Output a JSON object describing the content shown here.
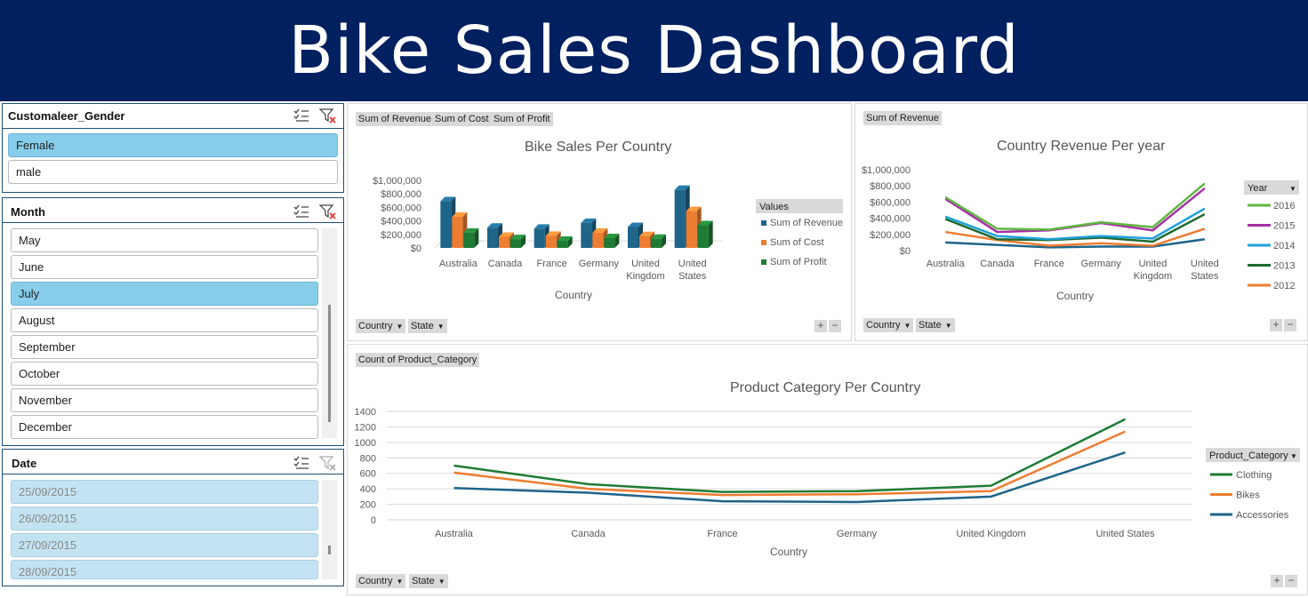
{
  "title": "Bike Sales Dashboard",
  "slicers": {
    "gender": {
      "title": "Customaleer_Gender",
      "items": [
        {
          "label": "Female",
          "state": "selected"
        },
        {
          "label": "male",
          "state": "normal"
        }
      ]
    },
    "month": {
      "title": "Month",
      "items": [
        {
          "label": "May",
          "state": "normal"
        },
        {
          "label": "June",
          "state": "normal"
        },
        {
          "label": "July",
          "state": "selected"
        },
        {
          "label": "August",
          "state": "normal"
        },
        {
          "label": "September",
          "state": "normal"
        },
        {
          "label": "October",
          "state": "normal"
        },
        {
          "label": "November",
          "state": "normal"
        },
        {
          "label": "December",
          "state": "normal"
        }
      ]
    },
    "date": {
      "title": "Date",
      "items": [
        {
          "label": "25/09/2015",
          "state": "dim"
        },
        {
          "label": "26/09/2015",
          "state": "dim"
        },
        {
          "label": "27/09/2015",
          "state": "dim"
        },
        {
          "label": "28/09/2015",
          "state": "dim"
        }
      ]
    }
  },
  "field_buttons": {
    "country": "Country",
    "state": "State"
  },
  "colors": {
    "header": "#002060",
    "revenue": "#1f6489",
    "cost": "#ed7d31",
    "profit": "#1e7b34",
    "y2016": "#5fb843",
    "y2015": "#a531a4",
    "y2014": "#1fa0d8",
    "y2013": "#1e6b32",
    "y2012": "#ed7d31",
    "clothing": "#1e7b34",
    "bikes": "#ed7d31",
    "accessories": "#1f6489"
  },
  "chart_data": [
    {
      "type": "bar",
      "title": "Bike Sales Per Country",
      "value_pills": [
        "Sum of Revenue",
        "Sum of Cost",
        "Sum of Profit"
      ],
      "legend_title": "Values",
      "xlabel": "Country",
      "categories": [
        "Australia",
        "Canada",
        "France",
        "Germany",
        "United Kingdom",
        "United States"
      ],
      "series": [
        {
          "name": "Sum of Revenue",
          "values": [
            690000,
            300000,
            285000,
            370000,
            310000,
            860000
          ]
        },
        {
          "name": "Sum of Cost",
          "values": [
            460000,
            165000,
            180000,
            225000,
            175000,
            545000
          ]
        },
        {
          "name": "Sum of Profit",
          "values": [
            225000,
            130000,
            105000,
            145000,
            135000,
            335000
          ]
        }
      ],
      "ylim": [
        0,
        1000000
      ],
      "yticks": [
        "$0",
        "$200,000",
        "$400,000",
        "$600,000",
        "$800,000",
        "$1,000,000"
      ],
      "legend_position": "right"
    },
    {
      "type": "line",
      "title": "Country Revenue Per year",
      "value_pills": [
        "Sum of Revenue"
      ],
      "legend_title": "Year",
      "xlabel": "Country",
      "categories": [
        "Australia",
        "Canada",
        "France",
        "Germany",
        "United Kingdom",
        "United States"
      ],
      "series": [
        {
          "name": "2016",
          "values": [
            660000,
            270000,
            260000,
            350000,
            290000,
            830000
          ]
        },
        {
          "name": "2015",
          "values": [
            640000,
            230000,
            250000,
            340000,
            250000,
            770000
          ]
        },
        {
          "name": "2014",
          "values": [
            420000,
            180000,
            140000,
            180000,
            150000,
            520000
          ]
        },
        {
          "name": "2013",
          "values": [
            390000,
            140000,
            130000,
            160000,
            110000,
            450000
          ]
        },
        {
          "name": "2012",
          "values": [
            230000,
            130000,
            60000,
            90000,
            60000,
            270000
          ]
        },
        {
          "name": "",
          "values": [
            100000,
            70000,
            40000,
            50000,
            50000,
            140000
          ]
        }
      ],
      "ylim": [
        0,
        1000000
      ],
      "yticks": [
        "$0",
        "$200,000",
        "$400,000",
        "$600,000",
        "$800,000",
        "$1,000,000"
      ],
      "legend_position": "right"
    },
    {
      "type": "line",
      "title": "Product Category Per Country",
      "value_pills": [
        "Count of Product_Category"
      ],
      "legend_title": "Product_Category",
      "xlabel": "Country",
      "categories": [
        "Australia",
        "Canada",
        "France",
        "Germany",
        "United Kingdom",
        "United States"
      ],
      "series": [
        {
          "name": "Clothing",
          "values": [
            700,
            460,
            360,
            370,
            440,
            1300
          ]
        },
        {
          "name": "Bikes",
          "values": [
            610,
            400,
            320,
            330,
            370,
            1140
          ]
        },
        {
          "name": "Accessories",
          "values": [
            410,
            350,
            240,
            230,
            300,
            870
          ]
        }
      ],
      "ylim": [
        0,
        1400
      ],
      "yticks": [
        "0",
        "200",
        "400",
        "600",
        "800",
        "1000",
        "1200",
        "1400"
      ],
      "legend_position": "right"
    }
  ]
}
